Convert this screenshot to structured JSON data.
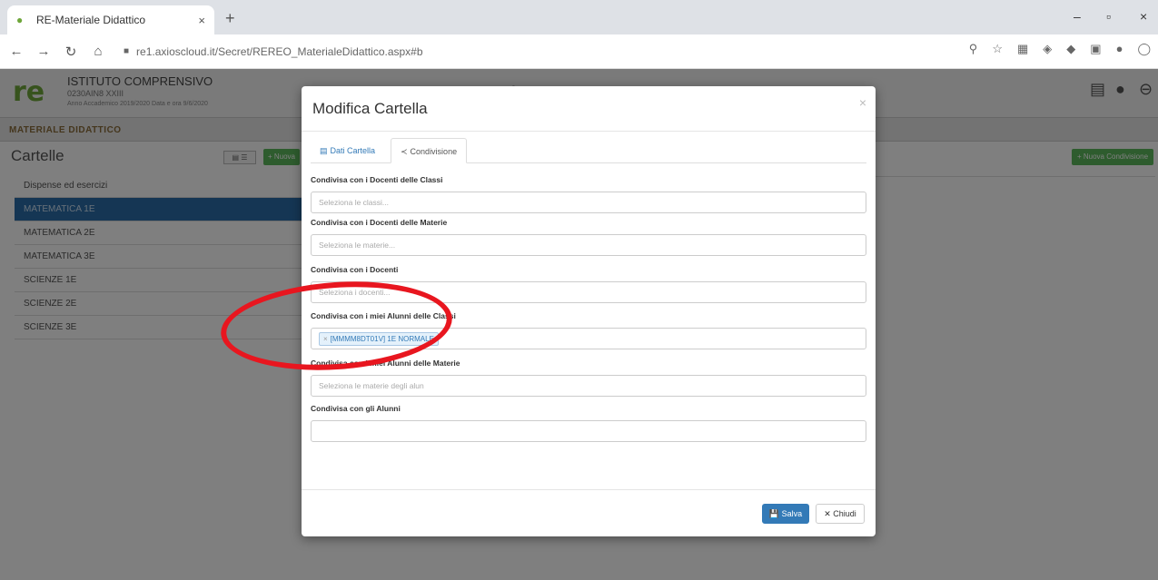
{
  "browser": {
    "tab_title": "RE-Materiale Didattico",
    "tab_close": "×",
    "new_tab": "+",
    "url": "re1.axioscloud.it/Secret/REREO_MaterialeDidattico.aspx#b",
    "minimize": "–",
    "maximize": "▫",
    "close": "×"
  },
  "app": {
    "school_name": "ISTITUTO COMPRENSIVO",
    "school_line2": "0230AIN8 XXIII",
    "school_line3": "Anno Accademico 2019/2020  Data e ora 9/6/2020",
    "breadcrumb": "MATERIALE DIDATTICO",
    "panel_title": "Cartelle",
    "new_folder_label": "+ Nuova",
    "new_folder_right_label": "+ Nuova Condivisione",
    "view_toggle": "▤ ☰",
    "folders": [
      {
        "label": "Dispense ed esercizi"
      },
      {
        "label": "MATEMATICA 1E"
      },
      {
        "label": "MATEMATICA 2E"
      },
      {
        "label": "MATEMATICA 3E"
      },
      {
        "label": "SCIENZE 1E"
      },
      {
        "label": "SCIENZE 2E"
      },
      {
        "label": "SCIENZE 3E"
      }
    ]
  },
  "modal": {
    "title": "Modifica Cartella",
    "close_symbol": "×",
    "tabs": [
      {
        "label": "Dati Cartella",
        "icon": "folder-icon"
      },
      {
        "label": "Condivisione",
        "icon": "share-icon"
      }
    ],
    "fields": [
      {
        "label": "Condivisa con i Docenti delle Classi",
        "placeholder": "Seleziona le classi...",
        "value": ""
      },
      {
        "label": "Condivisa con i Docenti delle Materie",
        "placeholder": "Seleziona le materie...",
        "value": ""
      },
      {
        "label": "Condivisa con i Docenti",
        "placeholder": "Seleziona i docenti...",
        "value": ""
      },
      {
        "label": "Condivisa con i miei Alunni delle Classi",
        "placeholder": "",
        "chip": "[MMMM8DT01V] 1E NORMALE"
      },
      {
        "label": "Condivisa con i miei Alunni delle Materie",
        "placeholder": "Seleziona le materie degli alun",
        "value": ""
      },
      {
        "label": "Condivisa con gli Alunni",
        "placeholder": "",
        "value": ""
      }
    ],
    "save_label": "💾 Salva",
    "close_label": "✕ Chiudi"
  },
  "colors": {
    "accent": "#337ab7",
    "brand_green": "#6ea63a",
    "annotation_red": "#e8161f"
  }
}
